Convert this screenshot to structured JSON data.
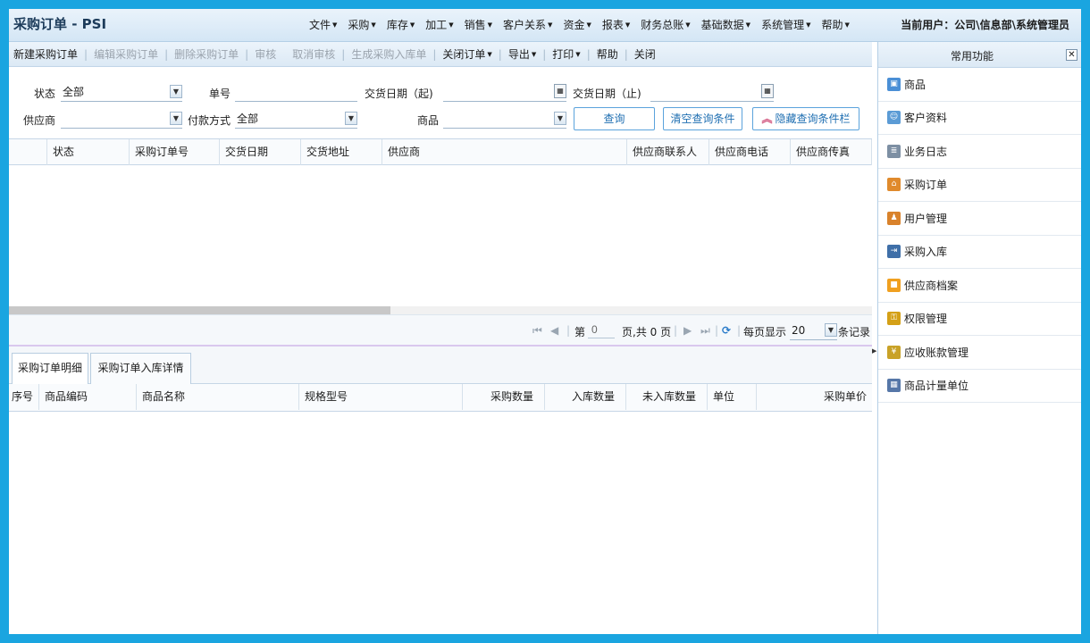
{
  "app": {
    "title": "采购订单 - PSI",
    "current_user": "当前用户：公司\\信息部\\系统管理员"
  },
  "menu": [
    "文件",
    "采购",
    "库存",
    "加工",
    "销售",
    "客户关系",
    "资金",
    "报表",
    "财务总账",
    "基础数据",
    "系统管理",
    "帮助"
  ],
  "toolbar": {
    "new_order": "新建采购订单",
    "edit_order": "编辑采购订单",
    "delete_order": "删除采购订单",
    "audit": "审核",
    "cancel_audit": "取消审核",
    "gen_inbound": "生成采购入库单",
    "close_order": "关闭订单",
    "export": "导出",
    "print": "打印",
    "help": "帮助",
    "close": "关闭"
  },
  "query": {
    "status_label": "状态",
    "status_value": "全部",
    "order_no_label": "单号",
    "order_no_value": "",
    "date_from_label": "交货日期（起)",
    "date_to_label": "交货日期（止)",
    "supplier_label": "供应商",
    "supplier_value": "",
    "pay_method_label": "付款方式",
    "pay_method_value": "全部",
    "goods_label": "商品",
    "goods_value": "",
    "query_btn": "查询",
    "clear_btn": "清空查询条件",
    "hide_btn": "隐藏查询条件栏"
  },
  "grid": {
    "columns": [
      "",
      "状态",
      "采购订单号",
      "交货日期",
      "交货地址",
      "供应商",
      "供应商联系人",
      "供应商电话",
      "供应商传真"
    ]
  },
  "pager": {
    "page_prefix": "第",
    "page_value": "0",
    "page_suffix": "页,共 0 页",
    "per_page_label": "每页显示",
    "per_page_value": "20",
    "records_label": "条记录"
  },
  "detail_tabs": [
    "采购订单明细",
    "采购订单入库详情"
  ],
  "detail_grid": {
    "columns": [
      "序号",
      "商品编码",
      "商品名称",
      "规格型号",
      "采购数量",
      "入库数量",
      "未入库数量",
      "单位",
      "采购单价"
    ]
  },
  "side_panel": {
    "title": "常用功能",
    "items": [
      {
        "label": "商品",
        "icon": "goods-icon",
        "color": "#4a8fd6"
      },
      {
        "label": "客户资料",
        "icon": "customer-icon",
        "color": "#5b9bd5"
      },
      {
        "label": "业务日志",
        "icon": "log-icon",
        "color": "#7d8fa3"
      },
      {
        "label": "采购订单",
        "icon": "purchase-order-icon",
        "color": "#e08a2c"
      },
      {
        "label": "用户管理",
        "icon": "users-icon",
        "color": "#d9822b"
      },
      {
        "label": "采购入库",
        "icon": "inbound-icon",
        "color": "#3f6fa8"
      },
      {
        "label": "供应商档案",
        "icon": "supplier-icon",
        "color": "#f0a020"
      },
      {
        "label": "权限管理",
        "icon": "lock-icon",
        "color": "#d4a017"
      },
      {
        "label": "应收账款管理",
        "icon": "receivable-icon",
        "color": "#c9a227"
      },
      {
        "label": "商品计量单位",
        "icon": "unit-icon",
        "color": "#5677a8"
      }
    ]
  }
}
